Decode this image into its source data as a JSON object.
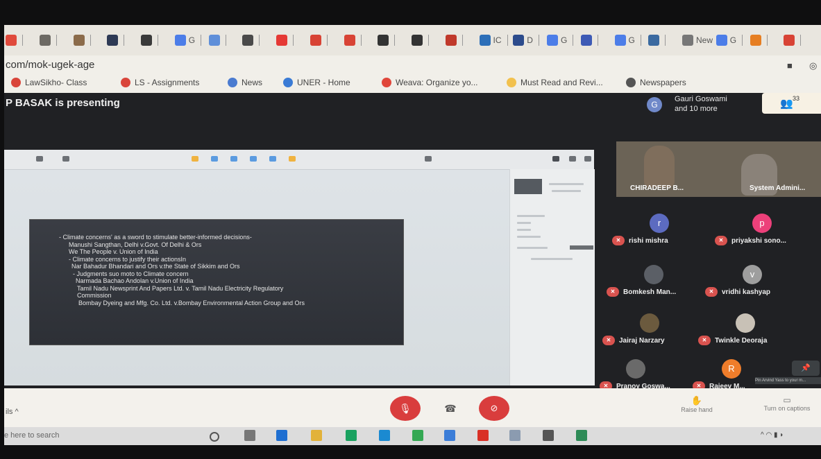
{
  "browser": {
    "tabs": [
      {
        "icon": "red-circle-icon",
        "color": "#e04a3c",
        "label": ""
      },
      {
        "icon": "profile-icon",
        "color": "#6d6a64",
        "label": ""
      },
      {
        "icon": "image-icon",
        "color": "#8b6b4a",
        "label": ""
      },
      {
        "icon": "site-icon",
        "color": "#2e3a55",
        "label": ""
      },
      {
        "icon": "book-icon",
        "color": "#3a3a3a",
        "label": ""
      },
      {
        "icon": "google-icon",
        "color": "#4c7de8",
        "label": "G"
      },
      {
        "icon": "bookmark-icon",
        "color": "#5f8fd9",
        "label": ""
      },
      {
        "icon": "globe-icon",
        "color": "#4a4a4a",
        "label": ""
      },
      {
        "icon": "youtube-icon",
        "color": "#e53935",
        "label": ""
      },
      {
        "icon": "red-circle-icon",
        "color": "#d84335",
        "label": ""
      },
      {
        "icon": "red-circle-icon",
        "color": "#d84335",
        "label": ""
      },
      {
        "icon": "github-icon",
        "color": "#333333",
        "label": ""
      },
      {
        "icon": "github-icon",
        "color": "#333333",
        "label": ""
      },
      {
        "icon": "pdf-icon",
        "color": "#c0392b",
        "label": ""
      },
      {
        "icon": "ic-icon",
        "color": "#2d6fb8",
        "label": "IC"
      },
      {
        "icon": "doc-icon",
        "color": "#2c4b8c",
        "label": "D"
      },
      {
        "icon": "google-icon",
        "color": "#4c7de8",
        "label": "G"
      },
      {
        "icon": "forms-icon",
        "color": "#3d5ab5",
        "label": ""
      },
      {
        "icon": "google-icon",
        "color": "#4c7de8",
        "label": "G"
      },
      {
        "icon": "photo-icon",
        "color": "#3b6aa0",
        "label": ""
      },
      {
        "icon": "new-tab-icon",
        "color": "#777777",
        "label": "New"
      },
      {
        "icon": "google-icon",
        "color": "#4c7de8",
        "label": "G"
      },
      {
        "icon": "rainbow-icon",
        "color": "#e67e22",
        "label": ""
      },
      {
        "icon": "red-circle-icon",
        "color": "#d84335",
        "label": ""
      }
    ],
    "url": "com/mok-ugek-age",
    "bookmarks": [
      {
        "label": "LawSikho- Class",
        "color": "#d9453a"
      },
      {
        "label": "LS - Assignments",
        "color": "#d9453a"
      },
      {
        "label": "News",
        "color": "#4a7bd0"
      },
      {
        "label": "UNER - Home",
        "color": "#3a7bd5"
      },
      {
        "label": "Weava: Organize yo...",
        "color": "#e0463a"
      },
      {
        "label": "Must Read and Revi...",
        "color": "#f2c14e"
      },
      {
        "label": "Newspapers",
        "color": "#555555"
      }
    ]
  },
  "meet": {
    "presenting_text": "P BASAK is presenting",
    "presenter_avatar_letter": "G",
    "presenter_line1": "Gauri Goswami",
    "presenter_line2": "and 10 more",
    "people_count": "33",
    "slide_lines": [
      "- Climate concerns' as a sword to stimulate better-informed decisions-",
      "Manushi Sangthan, Delhi v.Govt. Of Delhi & Ors",
      "We The People v. Union of India",
      "- Climate concerns to justify their actionsIn",
      "Nar Bahadur Bhandari and Ors v.the State of Sikkim and Ors",
      "- Judgments suo moto to Climate concern",
      "Narmada Bachao Andolan v.Union of India",
      "Tamil Nadu Newsprint And Papers Ltd. v. Tamil Nadu Electricity Regulatory",
      "Commission",
      "Bombay Dyeing and Mfg. Co. Ltd. v.Bombay Environmental Action Group and Ors"
    ],
    "video_names": [
      "CHIRADEEP B...",
      "System Admini..."
    ],
    "participants": [
      {
        "name": "rishi mishra",
        "letter": "r",
        "color": "#5c6bc0"
      },
      {
        "name": "priyakshi sono...",
        "letter": "p",
        "color": "#ec407a"
      },
      {
        "name": "Bomkesh Man...",
        "letter": "",
        "color": "#5b5f66"
      },
      {
        "name": "vridhi kashyap",
        "letter": "v",
        "color": "#9e9e9e"
      },
      {
        "name": "Jairaj Narzary",
        "letter": "",
        "color": "#6b5a3e"
      },
      {
        "name": "Twinkle Deoraja",
        "letter": "",
        "color": "#c8c1b6"
      },
      {
        "name": "Pranoy Goswa...",
        "letter": "",
        "color": "#6a6a6a"
      },
      {
        "name": "Rajeev M...",
        "letter": "R",
        "color": "#ef7d2b"
      }
    ],
    "pin_tooltip": "Pin Arvind Yass to your m...",
    "details_label": "ils ^",
    "raise_hand": "Raise hand",
    "captions": "Turn on captions"
  },
  "taskbar": {
    "search_text": "e here to search"
  }
}
